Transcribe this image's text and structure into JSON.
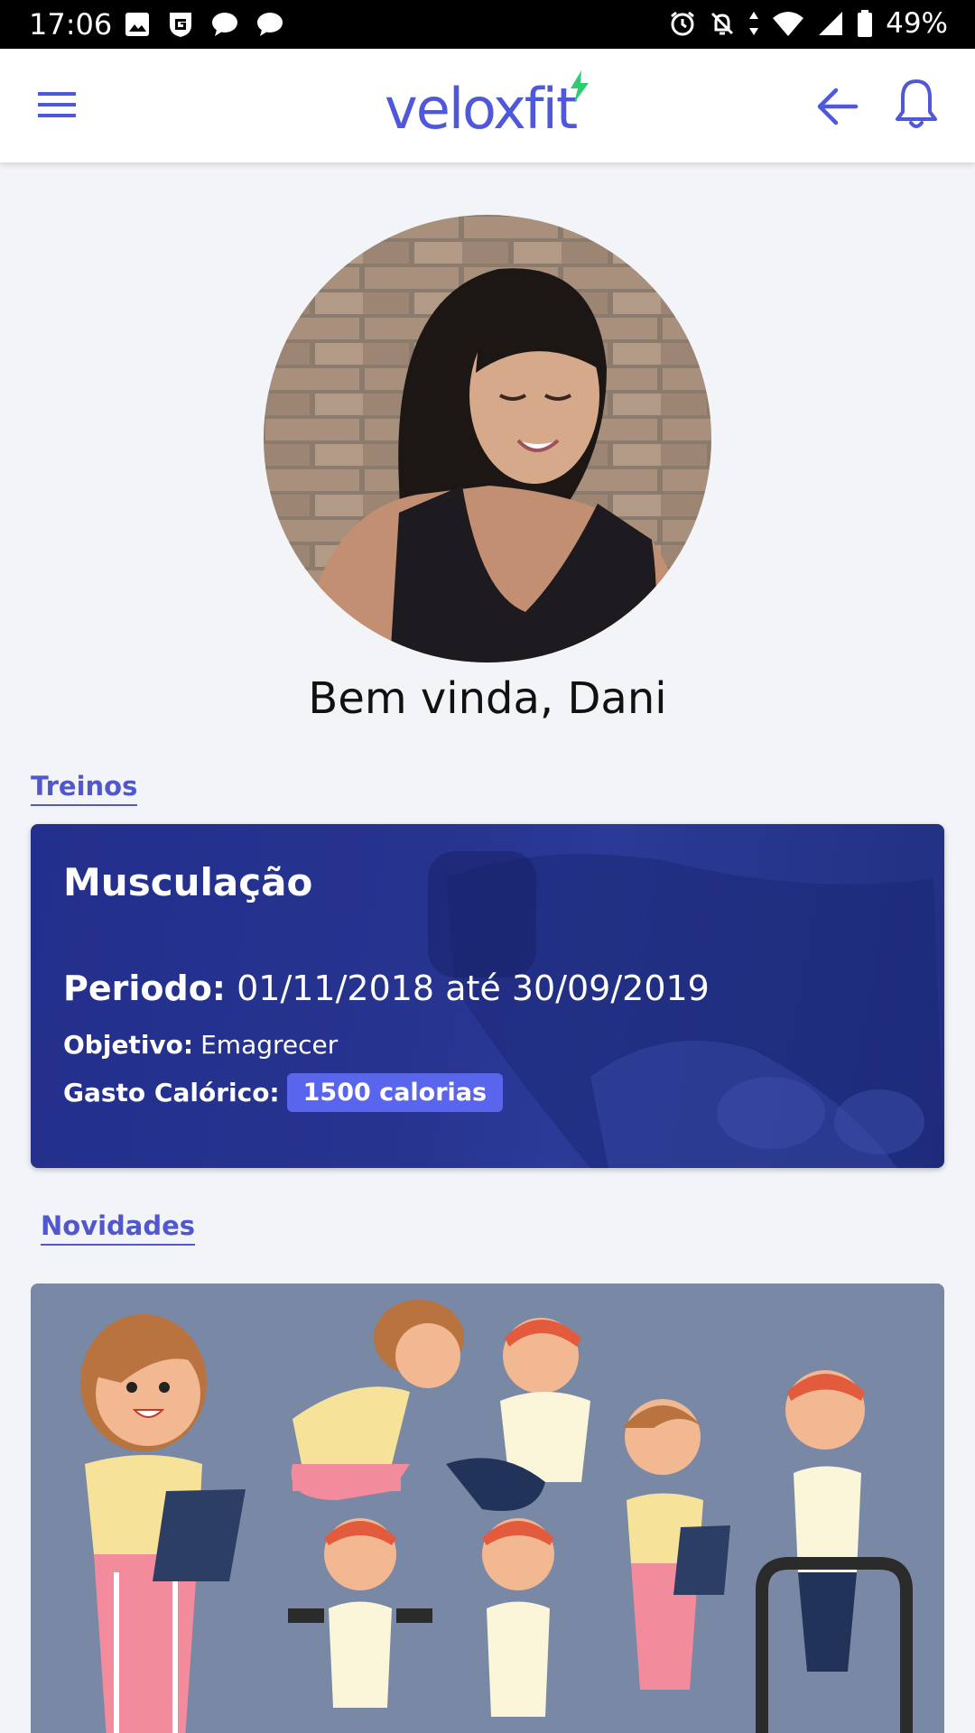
{
  "status_bar": {
    "time": "17:06",
    "battery": "49%"
  },
  "app": {
    "logo": "veloxfit",
    "accent_color": "#4f58d9",
    "bolt_color": "#2ecc71"
  },
  "profile": {
    "welcome": "Bem vinda, Dani"
  },
  "sections": {
    "treinos": "Treinos",
    "novidades": "Novidades"
  },
  "workout": {
    "title": "Musculação",
    "period_label": "Periodo:",
    "period_value": "01/11/2018 até 30/09/2019",
    "goal_label": "Objetivo:",
    "goal_value": "Emagrecer",
    "calories_label": "Gasto Calórico:",
    "calories_value": "1500 calorias"
  },
  "icons": {
    "menu": "menu-icon",
    "back": "arrow-left-icon",
    "bell": "bell-icon"
  }
}
